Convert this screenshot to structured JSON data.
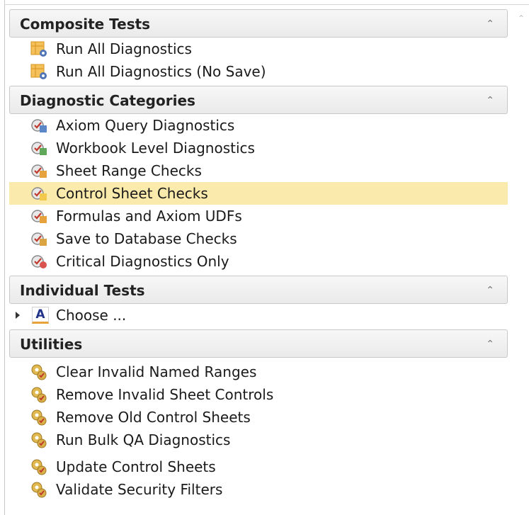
{
  "sections": [
    {
      "title": "Composite Tests",
      "items": [
        {
          "label": "Run All Diagnostics",
          "icon": "run-all-diagnostics-icon"
        },
        {
          "label": "Run All Diagnostics (No Save)",
          "icon": "run-all-diagnostics-icon"
        }
      ]
    },
    {
      "title": "Diagnostic Categories",
      "items": [
        {
          "label": "Axiom Query Diagnostics",
          "icon": "diagnostic-check-icon"
        },
        {
          "label": "Workbook Level Diagnostics",
          "icon": "diagnostic-check-icon"
        },
        {
          "label": "Sheet Range Checks",
          "icon": "diagnostic-check-icon"
        },
        {
          "label": "Control Sheet Checks",
          "icon": "diagnostic-check-icon",
          "selected": true
        },
        {
          "label": "Formulas and Axiom UDFs",
          "icon": "diagnostic-check-icon"
        },
        {
          "label": "Save to Database Checks",
          "icon": "diagnostic-check-icon"
        },
        {
          "label": "Critical Diagnostics Only",
          "icon": "diagnostic-check-icon"
        }
      ]
    },
    {
      "title": "Individual Tests",
      "items": [
        {
          "label": "Choose ...",
          "icon": "text-a-icon"
        }
      ]
    },
    {
      "title": "Utilities",
      "items": [
        {
          "label": "Clear Invalid Named Ranges",
          "icon": "utility-gears-icon"
        },
        {
          "label": "Remove Invalid Sheet Controls",
          "icon": "utility-gears-icon"
        },
        {
          "label": "Remove Old Control Sheets",
          "icon": "utility-gears-icon"
        },
        {
          "label": "Run Bulk QA Diagnostics",
          "icon": "utility-gears-icon"
        },
        {
          "label": "Update Control Sheets",
          "icon": "utility-gears-icon"
        },
        {
          "label": "Validate Security Filters",
          "icon": "utility-gears-icon"
        }
      ]
    }
  ],
  "colors": {
    "selected_row": "#faeaab",
    "header_border": "#c8c8c8"
  }
}
